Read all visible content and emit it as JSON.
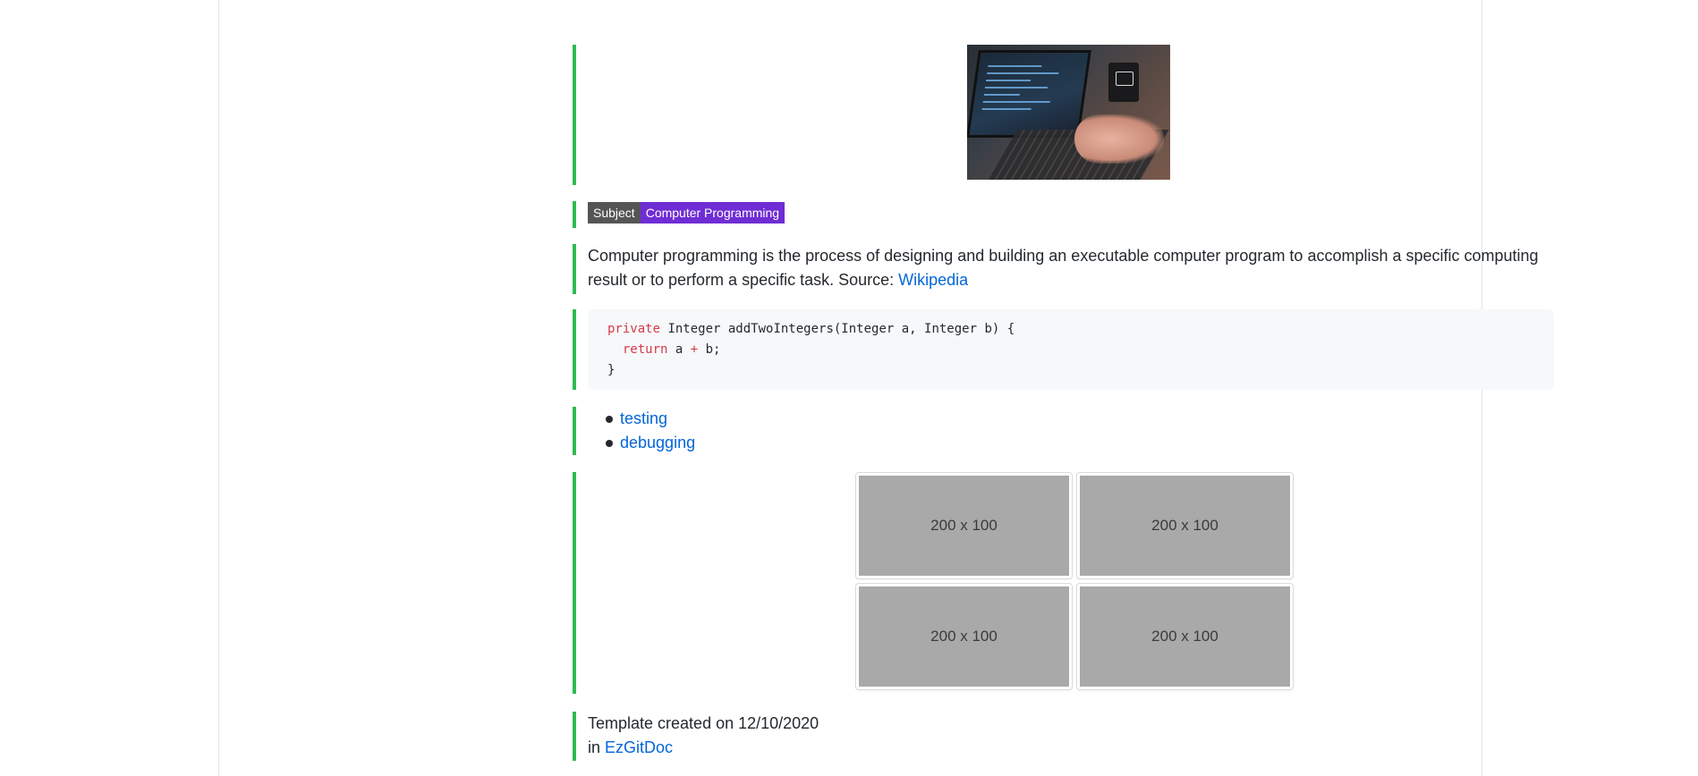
{
  "hero": {
    "image": "laptop-coding-photo"
  },
  "badge": {
    "key": "Subject",
    "value": "Computer Programming"
  },
  "description": {
    "text": "Computer programming is the process of designing and building an executable computer program to accomplish a specific computing result or to perform a specific task. Source: ",
    "link": "Wikipedia"
  },
  "code": {
    "line1_kw": "private",
    "line1_rest": " Integer addTwoIntegers(Integer a, Integer b) {",
    "line2_kw": "return",
    "line2_a": " a ",
    "line2_op": "+",
    "line2_b": " b;",
    "line3": "}"
  },
  "list": {
    "items": [
      "testing",
      "debugging"
    ]
  },
  "grid": {
    "cells": [
      "200 x 100",
      "200 x 100",
      "200 x 100",
      "200 x 100"
    ]
  },
  "footer": {
    "line1": "Template created on 12/10/2020",
    "in_label": "in ",
    "link": "EzGitDoc"
  },
  "colors": {
    "accent_bar": "#2fbb4f",
    "badge_value_bg": "#6f2dd4",
    "link": "#0366d6"
  }
}
